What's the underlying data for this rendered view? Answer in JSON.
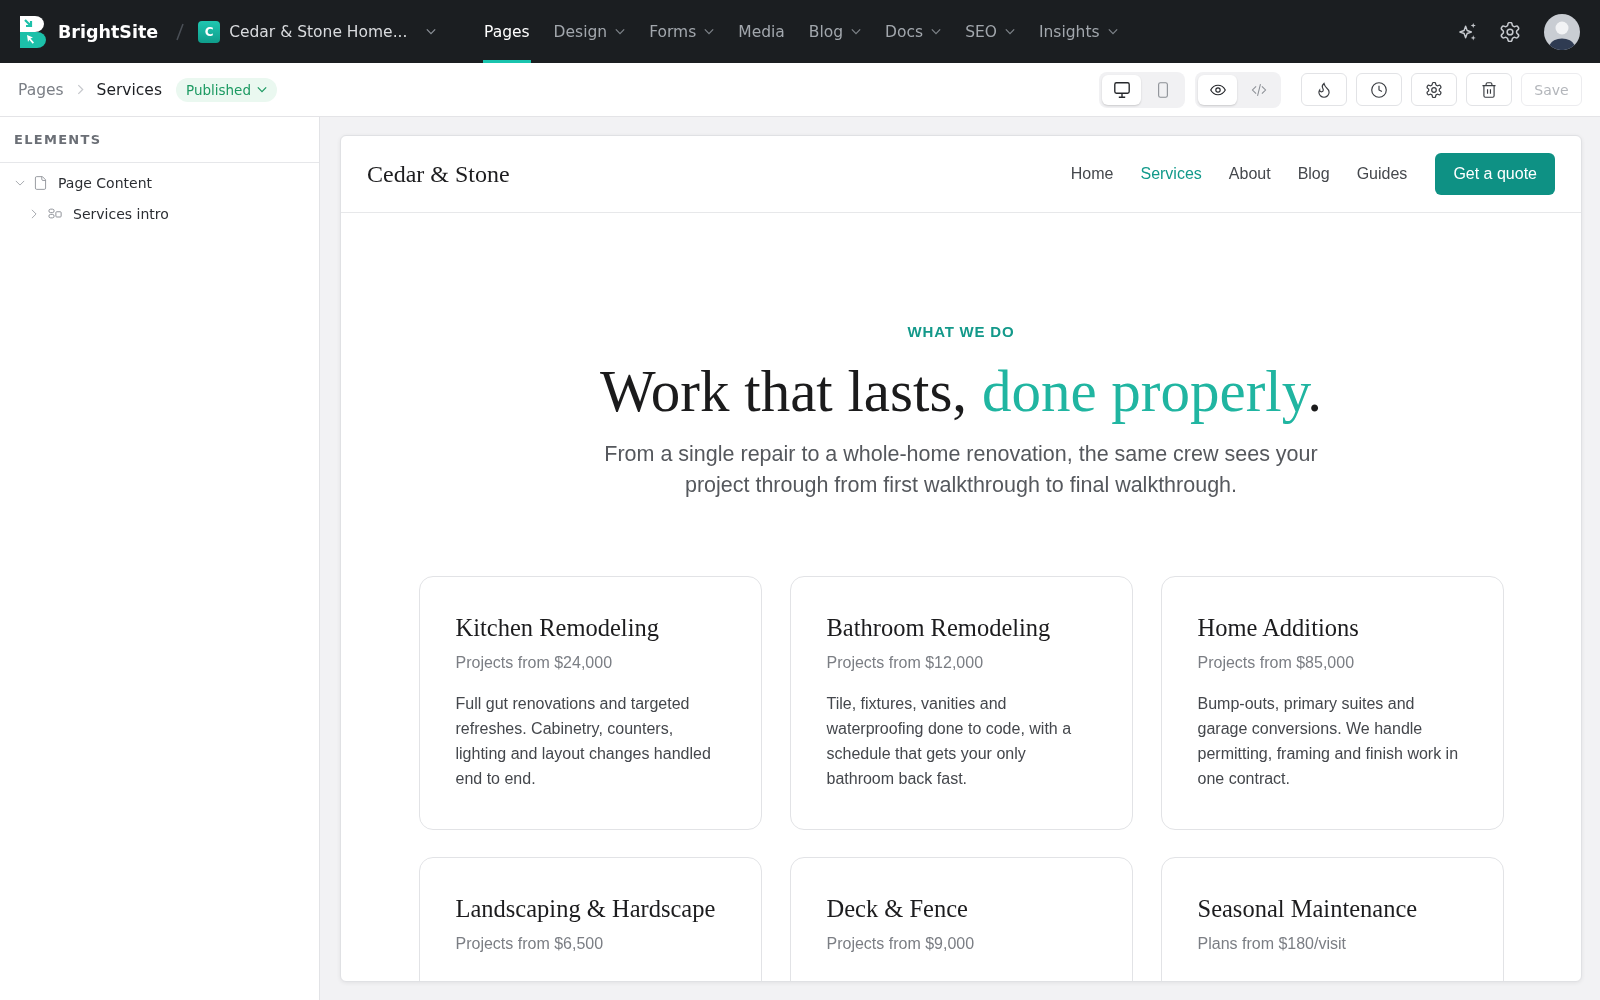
{
  "app_bar": {
    "brand": "BrightSite",
    "project": {
      "initial": "C",
      "name": "Cedar & Stone Home..."
    },
    "nav": [
      {
        "label": "Pages",
        "selected": true,
        "has_menu": false
      },
      {
        "label": "Design",
        "selected": false,
        "has_menu": true
      },
      {
        "label": "Forms",
        "selected": false,
        "has_menu": true
      },
      {
        "label": "Media",
        "selected": false,
        "has_menu": false
      },
      {
        "label": "Blog",
        "selected": false,
        "has_menu": true
      },
      {
        "label": "Docs",
        "selected": false,
        "has_menu": true
      },
      {
        "label": "SEO",
        "selected": false,
        "has_menu": true
      },
      {
        "label": "Insights",
        "selected": false,
        "has_menu": true
      }
    ]
  },
  "toolbar": {
    "breadcrumb": [
      "Pages",
      "Services"
    ],
    "status": "Published",
    "device_modes": [
      {
        "kind": "desktop",
        "selected": true
      },
      {
        "kind": "mobile",
        "selected": false
      }
    ],
    "view_modes": [
      {
        "kind": "preview",
        "selected": true
      },
      {
        "kind": "code",
        "selected": false
      }
    ],
    "save": {
      "label": "Save",
      "disabled": true
    }
  },
  "sidebar": {
    "title": "ELEMENTS",
    "tree": [
      {
        "label": "Page Content",
        "kind": "page",
        "expanded": true,
        "children": [
          {
            "label": "Services intro",
            "kind": "section",
            "expanded": false
          }
        ]
      }
    ]
  },
  "preview": {
    "site_name": "Cedar & Stone",
    "nav": [
      {
        "label": "Home",
        "selected": false
      },
      {
        "label": "Services",
        "selected": true
      },
      {
        "label": "About",
        "selected": false
      },
      {
        "label": "Blog",
        "selected": false
      },
      {
        "label": "Guides",
        "selected": false
      }
    ],
    "cta": "Get a quote",
    "eyebrow": "WHAT WE DO",
    "headline": {
      "lead": "Work that lasts,",
      "accent": "done properly",
      "end": "."
    },
    "intro": "From a single repair to a whole-home renovation, the same crew sees your project through from first walkthrough to final walkthrough.",
    "cards": [
      {
        "title": "Kitchen Remodeling",
        "price": "Projects from $24,000",
        "description": "Full gut renovations and targeted refreshes. Cabinetry, counters, lighting and layout changes handled end to end."
      },
      {
        "title": "Bathroom Remodeling",
        "price": "Projects from $12,000",
        "description": "Tile, fixtures, vanities and waterproofing done to code, with a schedule that gets your only bathroom back fast."
      },
      {
        "title": "Home Additions",
        "price": "Projects from $85,000",
        "description": "Bump-outs, primary suites and garage conversions. We handle permitting, framing and finish work in one contract."
      },
      {
        "title": "Landscaping & Hardscape",
        "price": "Projects from $6,500"
      },
      {
        "title": "Deck & Fence",
        "price": "Projects from $9,000"
      },
      {
        "title": "Seasonal Maintenance",
        "price": "Plans from $180/visit"
      }
    ]
  }
}
